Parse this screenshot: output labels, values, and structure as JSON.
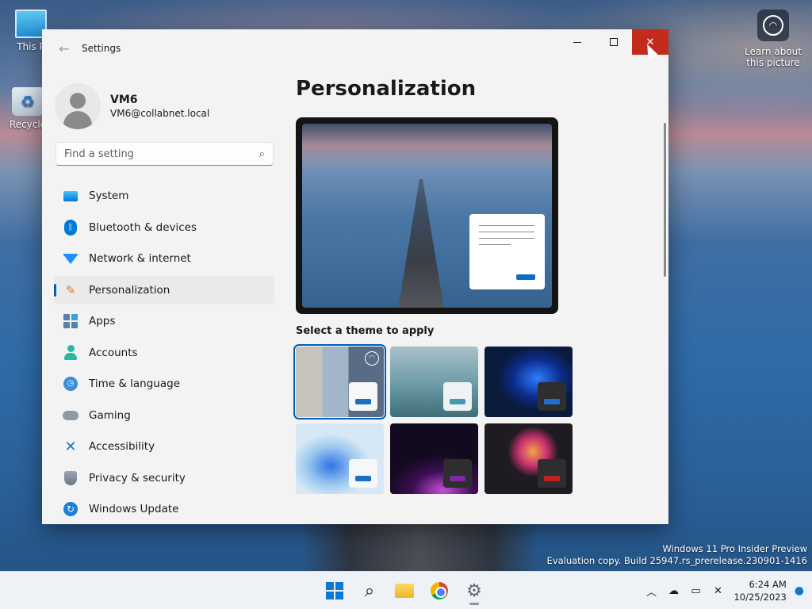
{
  "desktop": {
    "icons": [
      {
        "label": "This P"
      },
      {
        "label": "Recycle"
      }
    ],
    "learn_about": "Learn about\nthis picture",
    "watermark": {
      "line1": "Windows 11 Pro Insider Preview",
      "line2": "Evaluation copy. Build 25947.rs_prerelease.230901-1416"
    }
  },
  "window": {
    "title": "Settings",
    "back_glyph": "←",
    "minimize_glyph": "",
    "maximize_glyph": "",
    "close_glyph": "✕"
  },
  "profile": {
    "name": "VM6",
    "email": "VM6@collabnet.local"
  },
  "search": {
    "placeholder": "Find a setting",
    "icon": "search-icon"
  },
  "nav": {
    "items": [
      {
        "label": "System",
        "icon": "system-icon"
      },
      {
        "label": "Bluetooth & devices",
        "icon": "bluetooth-icon"
      },
      {
        "label": "Network & internet",
        "icon": "wifi-icon"
      },
      {
        "label": "Personalization",
        "icon": "brush-icon",
        "active": true
      },
      {
        "label": "Apps",
        "icon": "apps-icon"
      },
      {
        "label": "Accounts",
        "icon": "accounts-icon"
      },
      {
        "label": "Time & language",
        "icon": "clock-icon"
      },
      {
        "label": "Gaming",
        "icon": "gamepad-icon"
      },
      {
        "label": "Accessibility",
        "icon": "accessibility-icon"
      },
      {
        "label": "Privacy & security",
        "icon": "shield-icon"
      },
      {
        "label": "Windows Update",
        "icon": "update-icon"
      }
    ]
  },
  "content": {
    "page_title": "Personalization",
    "theme_section_label": "Select a theme to apply",
    "themes": [
      {
        "name": "theme-windows-spotlight",
        "selected": true
      },
      {
        "name": "theme-glow"
      },
      {
        "name": "theme-windows-dark"
      },
      {
        "name": "theme-windows-light"
      },
      {
        "name": "theme-sunrise"
      },
      {
        "name": "theme-flow"
      }
    ]
  },
  "taskbar": {
    "apps": [
      "start",
      "search",
      "file-explorer",
      "chrome",
      "settings"
    ],
    "time": "6:24 AM",
    "date": "10/25/2023"
  },
  "colors": {
    "accent": "#005fb8",
    "close_hover": "#c42b1c",
    "window_bg": "#f3f3f3"
  }
}
